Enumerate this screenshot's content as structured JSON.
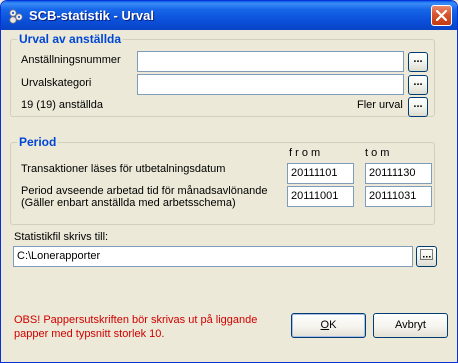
{
  "window": {
    "title": "SCB-statistik - Urval",
    "close_label": "×"
  },
  "urval": {
    "legend": "Urval av anställda",
    "anstallningsnummer_label": "Anställningsnummer",
    "anstallningsnummer_value": "",
    "anstallningsnummer_button": "...",
    "urvalskategori_label": "Urvalskategori",
    "urvalskategori_value": "",
    "urvalskategori_button": "...",
    "count_text": "19 (19) anställda",
    "fler_urval_label": "Fler urval",
    "fler_urval_button": "..."
  },
  "period": {
    "legend": "Period",
    "from_header": "f r o m",
    "tom_header": "t o m",
    "row1_label": "Transaktioner läses för utbetalningsdatum",
    "row1_from": "20111101",
    "row1_tom": "20111130",
    "row2_label_line1": "Period avseende arbetad tid för månadsavlönande",
    "row2_label_line2": "(Gäller enbart anställda med arbetsschema)",
    "row2_from": "20111001",
    "row2_tom": "20111031"
  },
  "file": {
    "label": "Statistikfil skrivs till:",
    "path": "C:\\Lonerapporter",
    "browse_button": "..."
  },
  "notice": {
    "line1": "OBS! Pappersutskriften bör skrivas ut på liggande",
    "line2": "papper med typsnitt storlek 10."
  },
  "buttons": {
    "ok_prefix": "O",
    "ok_rest": "K",
    "cancel": "Avbryt"
  },
  "colors": {
    "accent": "#0046d5",
    "notice": "#d00000",
    "title_bar": "#0a4fd8"
  }
}
